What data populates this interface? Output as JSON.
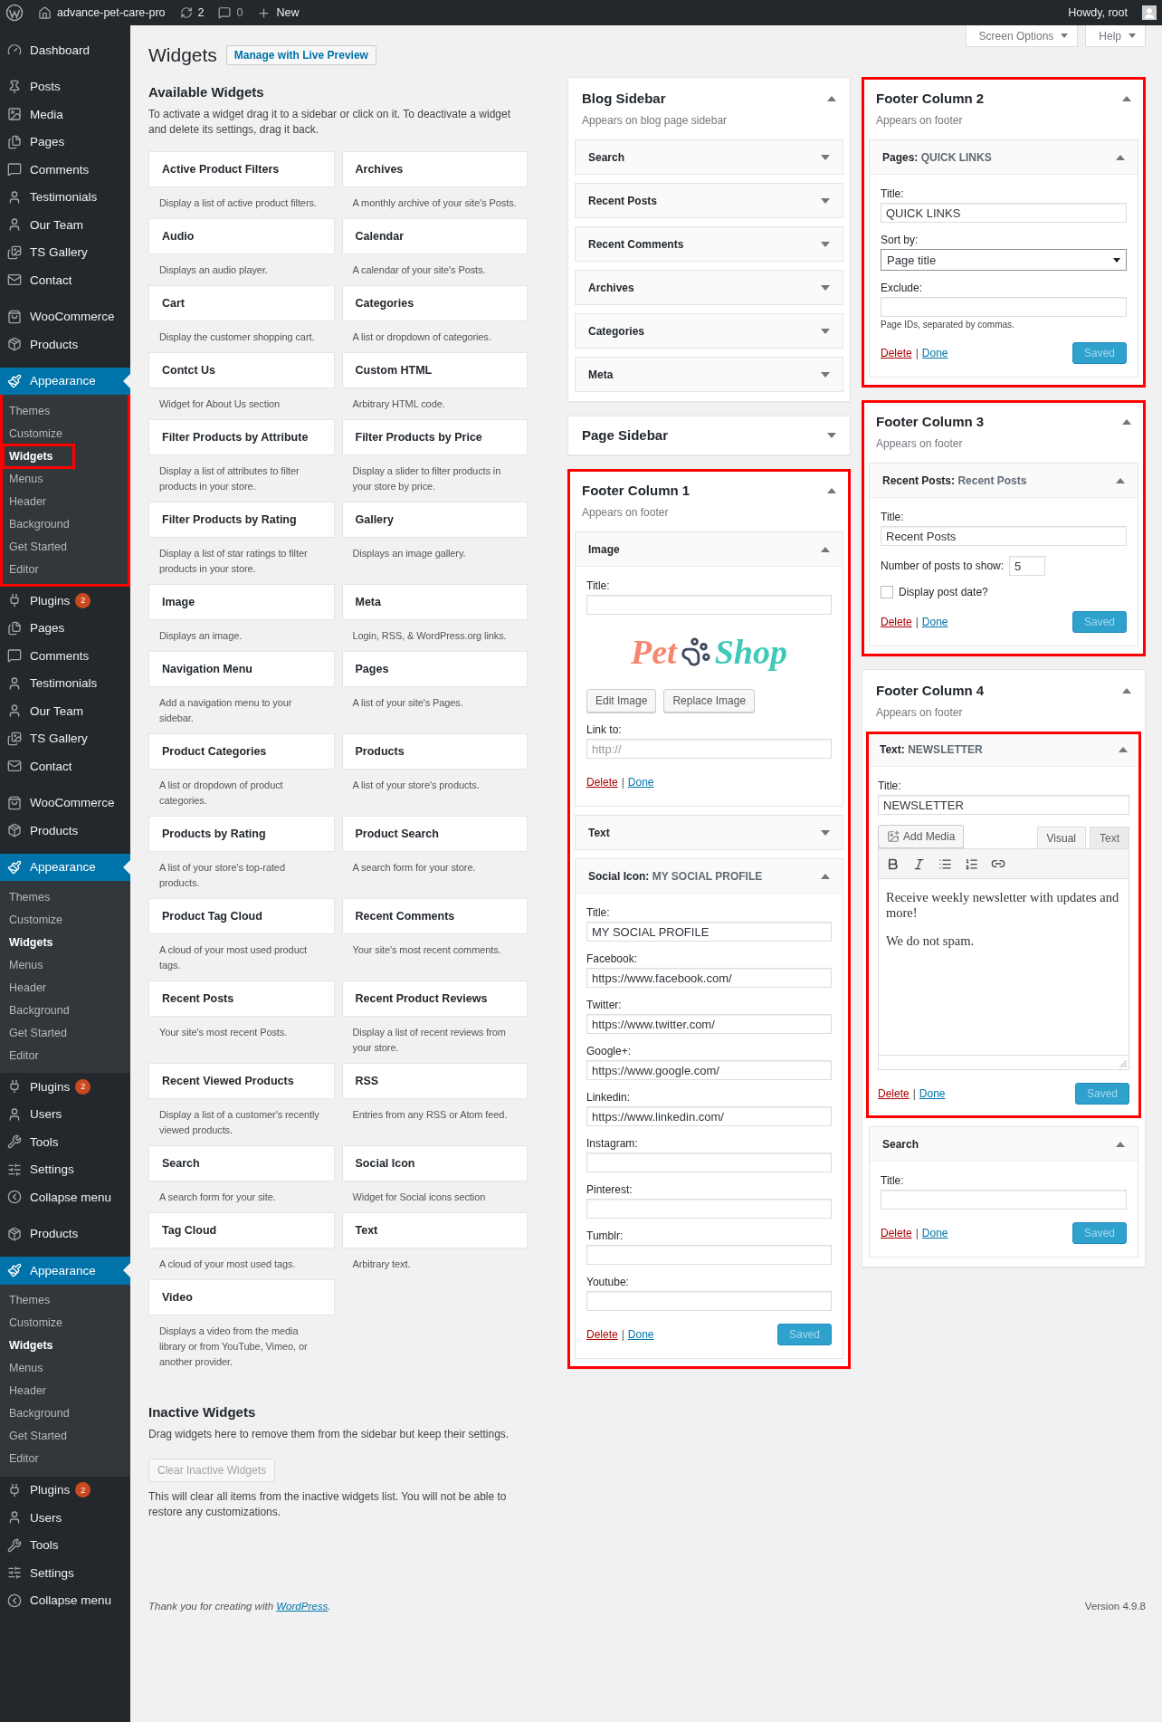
{
  "admin_bar": {
    "site": "advance-pet-care-pro",
    "updates": "2",
    "comments": "0",
    "new": "New",
    "greeting": "Howdy, root"
  },
  "screen_meta": [
    {
      "label": "Screen Options"
    },
    {
      "label": "Help"
    }
  ],
  "sidebar": {
    "items": [
      {
        "kind": "menu",
        "label": "Dashboard",
        "selected": false,
        "highlighted": false
      },
      {
        "kind": "separator"
      },
      {
        "kind": "menu",
        "label": "Posts",
        "selected": false,
        "highlighted": false
      },
      {
        "kind": "menu",
        "label": "Media",
        "selected": false,
        "highlighted": false
      },
      {
        "kind": "menu",
        "label": "Pages",
        "selected": false,
        "highlighted": false
      },
      {
        "kind": "menu",
        "label": "Comments",
        "selected": false,
        "highlighted": false
      },
      {
        "kind": "menu",
        "label": "Testimonials",
        "selected": false,
        "highlighted": false
      },
      {
        "kind": "menu",
        "label": "Our Team",
        "selected": false,
        "highlighted": false
      },
      {
        "kind": "menu",
        "label": "TS Gallery",
        "selected": false,
        "highlighted": false
      },
      {
        "kind": "menu",
        "label": "Contact",
        "selected": false,
        "highlighted": false
      },
      {
        "kind": "separator"
      },
      {
        "kind": "menu",
        "label": "WooCommerce",
        "selected": false,
        "highlighted": false
      },
      {
        "kind": "menu",
        "label": "Products",
        "selected": false,
        "highlighted": false
      },
      {
        "kind": "separator"
      },
      {
        "kind": "menu",
        "label": "Appearance",
        "selected": true,
        "highlighted": true,
        "children": [
          {
            "label": "Themes",
            "selected": false,
            "highlighted": false
          },
          {
            "label": "Customize",
            "selected": false,
            "highlighted": false
          },
          {
            "label": "Widgets",
            "selected": true,
            "highlighted": true
          },
          {
            "label": "Menus",
            "selected": false,
            "highlighted": false
          },
          {
            "label": "Header",
            "selected": false,
            "highlighted": false
          },
          {
            "label": "Background",
            "selected": false,
            "highlighted": false
          },
          {
            "label": "Get Started",
            "selected": false,
            "highlighted": false
          },
          {
            "label": "Editor",
            "selected": false,
            "highlighted": false
          }
        ]
      },
      {
        "kind": "menu",
        "label": "Plugins",
        "badge": "2",
        "selected": false,
        "highlighted": false
      },
      {
        "kind": "menu",
        "label": "Pages",
        "selected": false,
        "highlighted": false
      },
      {
        "kind": "menu",
        "label": "Comments",
        "selected": false,
        "highlighted": false
      },
      {
        "kind": "menu",
        "label": "Testimonials",
        "selected": false,
        "highlighted": false
      },
      {
        "kind": "menu",
        "label": "Our Team",
        "selected": false,
        "highlighted": false
      },
      {
        "kind": "menu",
        "label": "TS Gallery",
        "selected": false,
        "highlighted": false
      },
      {
        "kind": "menu",
        "label": "Contact",
        "selected": false,
        "highlighted": false
      },
      {
        "kind": "separator"
      },
      {
        "kind": "menu",
        "label": "WooCommerce",
        "selected": false,
        "highlighted": false
      },
      {
        "kind": "menu",
        "label": "Products",
        "selected": false,
        "highlighted": false
      },
      {
        "kind": "separator"
      },
      {
        "kind": "menu",
        "label": "Appearance",
        "selected": true,
        "highlighted": false,
        "children": [
          {
            "label": "Themes",
            "selected": false,
            "highlighted": false
          },
          {
            "label": "Customize",
            "selected": false,
            "highlighted": false
          },
          {
            "label": "Widgets",
            "selected": true,
            "highlighted": false
          },
          {
            "label": "Menus",
            "selected": false,
            "highlighted": false
          },
          {
            "label": "Header",
            "selected": false,
            "highlighted": false
          },
          {
            "label": "Background",
            "selected": false,
            "highlighted": false
          },
          {
            "label": "Get Started",
            "selected": false,
            "highlighted": false
          },
          {
            "label": "Editor",
            "selected": false,
            "highlighted": false
          }
        ]
      },
      {
        "kind": "menu",
        "label": "Plugins",
        "badge": "2",
        "selected": false,
        "highlighted": false
      },
      {
        "kind": "menu",
        "label": "Users",
        "selected": false,
        "highlighted": false
      },
      {
        "kind": "menu",
        "label": "Tools",
        "selected": false,
        "highlighted": false
      },
      {
        "kind": "menu",
        "label": "Settings",
        "selected": false,
        "highlighted": false
      },
      {
        "kind": "menu",
        "label": "Collapse menu",
        "selected": false,
        "highlighted": false
      },
      {
        "kind": "separator"
      },
      {
        "kind": "menu",
        "label": "Products",
        "selected": false,
        "highlighted": false
      },
      {
        "kind": "separator"
      },
      {
        "kind": "menu",
        "label": "Appearance",
        "selected": true,
        "highlighted": false,
        "children": [
          {
            "label": "Themes",
            "selected": false,
            "highlighted": false
          },
          {
            "label": "Customize",
            "selected": false,
            "highlighted": false
          },
          {
            "label": "Widgets",
            "selected": true,
            "highlighted": false
          },
          {
            "label": "Menus",
            "selected": false,
            "highlighted": false
          },
          {
            "label": "Header",
            "selected": false,
            "highlighted": false
          },
          {
            "label": "Background",
            "selected": false,
            "highlighted": false
          },
          {
            "label": "Get Started",
            "selected": false,
            "highlighted": false
          },
          {
            "label": "Editor",
            "selected": false,
            "highlighted": false
          }
        ]
      },
      {
        "kind": "menu",
        "label": "Plugins",
        "badge": "2",
        "selected": false,
        "highlighted": false
      },
      {
        "kind": "menu",
        "label": "Users",
        "selected": false,
        "highlighted": false
      },
      {
        "kind": "menu",
        "label": "Tools",
        "selected": false,
        "highlighted": false
      },
      {
        "kind": "menu",
        "label": "Settings",
        "selected": false,
        "highlighted": false
      },
      {
        "kind": "menu",
        "label": "Collapse menu",
        "selected": false,
        "highlighted": false
      }
    ]
  },
  "page": {
    "title": "Widgets",
    "action": "Manage with Live Preview"
  },
  "available": {
    "heading": "Available Widgets",
    "description": "To activate a widget drag it to a sidebar or click on it. To deactivate a widget and delete its settings, drag it back.",
    "widgets": [
      {
        "name": "Active Product Filters",
        "description": "Display a list of active product filters."
      },
      {
        "name": "Archives",
        "description": "A monthly archive of your site's Posts."
      },
      {
        "name": "Audio",
        "description": "Displays an audio player."
      },
      {
        "name": "Calendar",
        "description": "A calendar of your site's Posts."
      },
      {
        "name": "Cart",
        "description": "Display the customer shopping cart."
      },
      {
        "name": "Categories",
        "description": "A list or dropdown of categories."
      },
      {
        "name": "Contct Us",
        "description": "Widget for About Us section"
      },
      {
        "name": "Custom HTML",
        "description": "Arbitrary HTML code."
      },
      {
        "name": "Filter Products by Attribute",
        "description": "Display a list of attributes to filter products in your store."
      },
      {
        "name": "Filter Products by Price",
        "description": "Display a slider to filter products in your store by price."
      },
      {
        "name": "Filter Products by Rating",
        "description": "Display a list of star ratings to filter products in your store."
      },
      {
        "name": "Gallery",
        "description": "Displays an image gallery."
      },
      {
        "name": "Image",
        "description": "Displays an image."
      },
      {
        "name": "Meta",
        "description": "Login, RSS, & WordPress.org links."
      },
      {
        "name": "Navigation Menu",
        "description": "Add a navigation menu to your sidebar."
      },
      {
        "name": "Pages",
        "description": "A list of your site's Pages."
      },
      {
        "name": "Product Categories",
        "description": "A list or dropdown of product categories."
      },
      {
        "name": "Products",
        "description": "A list of your store's products."
      },
      {
        "name": "Products by Rating",
        "description": "A list of your store's top-rated products."
      },
      {
        "name": "Product Search",
        "description": "A search form for your store."
      },
      {
        "name": "Product Tag Cloud",
        "description": "A cloud of your most used product tags."
      },
      {
        "name": "Recent Comments",
        "description": "Your site's most recent comments."
      },
      {
        "name": "Recent Posts",
        "description": "Your site's most recent Posts."
      },
      {
        "name": "Recent Product Reviews",
        "description": "Display a list of recent reviews from your store."
      },
      {
        "name": "Recent Viewed Products",
        "description": "Display a list of a customer's recently viewed products."
      },
      {
        "name": "RSS",
        "description": "Entries from any RSS or Atom feed."
      },
      {
        "name": "Search",
        "description": "A search form for your site."
      },
      {
        "name": "Social Icon",
        "description": "Widget for Social icons section"
      },
      {
        "name": "Tag Cloud",
        "description": "A cloud of your most used tags."
      },
      {
        "name": "Text",
        "description": "Arbitrary text."
      },
      {
        "name": "Video",
        "description": "Displays a video from the media library or from YouTube, Vimeo, or another provider."
      }
    ]
  },
  "inactive": {
    "heading": "Inactive Widgets",
    "description": "Drag widgets here to remove them from the sidebar but keep their settings.",
    "button": "Clear Inactive Widgets",
    "disabled": true,
    "note": "This will clear all items from the inactive widgets list. You will not be able to restore any customizations."
  },
  "widget_areas": [
    {
      "panels": [
        {
          "title": "Blog Sidebar",
          "description": "Appears on blog page sidebar",
          "expanded": true,
          "highlighted": false,
          "widgets": [
            {
              "name": "Search",
              "expanded": false,
              "highlighted": false
            },
            {
              "name": "Recent Posts",
              "expanded": false,
              "highlighted": false
            },
            {
              "name": "Recent Comments",
              "expanded": false,
              "highlighted": false
            },
            {
              "name": "Archives",
              "expanded": false,
              "highlighted": false
            },
            {
              "name": "Categories",
              "expanded": false,
              "highlighted": false
            },
            {
              "name": "Meta",
              "expanded": false,
              "highlighted": false
            }
          ]
        },
        {
          "title": "Page Sidebar",
          "expanded": false,
          "highlighted": false
        },
        {
          "title": "Footer Column 1",
          "description": "Appears on footer",
          "expanded": true,
          "highlighted": true,
          "widgets": [
            {
              "name": "Image",
              "expanded": true,
              "highlighted": false,
              "fields": [
                {
                  "kind": "text",
                  "label": "Title:"
                },
                {
                  "kind": "image",
                  "logo": [
                    "Pet",
                    "Shop"
                  ]
                },
                {
                  "kind": "buttons",
                  "labels": [
                    "Edit Image",
                    "Replace Image"
                  ]
                },
                {
                  "kind": "text",
                  "label": "Link to:",
                  "placeholder": "http://"
                }
              ],
              "actions": {
                "delete": "Delete",
                "separator": "|",
                "done": "Done"
              }
            },
            {
              "name": "Text",
              "expanded": false,
              "highlighted": false
            },
            {
              "name": "Social Icon:",
              "title": "MY SOCIAL PROFILE",
              "expanded": true,
              "highlighted": false,
              "fields": [
                {
                  "kind": "text",
                  "label": "Title:",
                  "value": "MY SOCIAL PROFILE"
                },
                {
                  "kind": "text",
                  "label": "Facebook:",
                  "value": "https://www.facebook.com/"
                },
                {
                  "kind": "text",
                  "label": "Twitter:",
                  "value": "https://www.twitter.com/"
                },
                {
                  "kind": "text",
                  "label": "Google+:",
                  "value": "https://www.google.com/"
                },
                {
                  "kind": "text",
                  "label": "Linkedin:",
                  "value": "https://www.linkedin.com/"
                },
                {
                  "kind": "text",
                  "label": "Instagram:"
                },
                {
                  "kind": "text",
                  "label": "Pinterest:"
                },
                {
                  "kind": "text",
                  "label": "Tumblr:"
                },
                {
                  "kind": "text",
                  "label": "Youtube:"
                }
              ],
              "actions": {
                "delete": "Delete",
                "separator": "|",
                "done": "Done",
                "save": "Saved"
              }
            }
          ]
        }
      ]
    },
    {
      "panels": [
        {
          "title": "Footer Column 2",
          "description": "Appears on footer",
          "expanded": true,
          "highlighted": true,
          "widgets": [
            {
              "name": "Pages:",
              "title": "QUICK LINKS",
              "expanded": true,
              "highlighted": false,
              "fields": [
                {
                  "kind": "text",
                  "label": "Title:",
                  "value": "QUICK LINKS"
                },
                {
                  "kind": "select",
                  "label": "Sort by:",
                  "value": "Page title"
                },
                {
                  "kind": "text",
                  "label": "Exclude:"
                },
                {
                  "kind": "hint",
                  "text": "Page IDs, separated by commas."
                }
              ],
              "actions": {
                "delete": "Delete",
                "separator": "|",
                "done": "Done",
                "save": "Saved"
              }
            }
          ]
        },
        {
          "title": "Footer Column 3",
          "description": "Appears on footer",
          "expanded": true,
          "highlighted": true,
          "widgets": [
            {
              "name": "Recent Posts:",
              "title": "Recent Posts",
              "expanded": true,
              "highlighted": false,
              "fields": [
                {
                  "kind": "text",
                  "label": "Title:",
                  "value": "Recent Posts"
                },
                {
                  "kind": "number",
                  "label": "Number of posts to show:",
                  "value": "5"
                },
                {
                  "kind": "checkbox",
                  "label": "Display post date?",
                  "checked": false
                }
              ],
              "actions": {
                "delete": "Delete",
                "separator": "|",
                "done": "Done",
                "save": "Saved"
              }
            }
          ]
        },
        {
          "title": "Footer Column 4",
          "description": "Appears on footer",
          "expanded": true,
          "highlighted": false,
          "widgets": [
            {
              "name": "Text:",
              "title": "NEWSLETTER",
              "expanded": true,
              "highlighted": true,
              "fields": [
                {
                  "kind": "text",
                  "label": "Title:",
                  "value": "NEWSLETTER"
                },
                {
                  "kind": "editor",
                  "media_button": "Add Media",
                  "tabs": [
                    {
                      "label": "Visual",
                      "selected": true
                    },
                    {
                      "label": "Text",
                      "selected": false
                    }
                  ],
                  "paragraphs": [
                    "Receive weekly newsletter with updates and more!",
                    "We do not spam."
                  ]
                }
              ],
              "actions": {
                "delete": "Delete",
                "separator": "|",
                "done": "Done",
                "save": "Saved"
              }
            },
            {
              "name": "Search",
              "expanded": true,
              "highlighted": false,
              "fields": [
                {
                  "kind": "text",
                  "label": "Title:"
                }
              ],
              "actions": {
                "delete": "Delete",
                "separator": "|",
                "done": "Done",
                "save": "Saved"
              }
            }
          ]
        }
      ]
    }
  ],
  "footer": {
    "credit": "Thank you for creating with ",
    "link": "WordPress",
    "end": ".",
    "version": "Version 4.9.8"
  }
}
